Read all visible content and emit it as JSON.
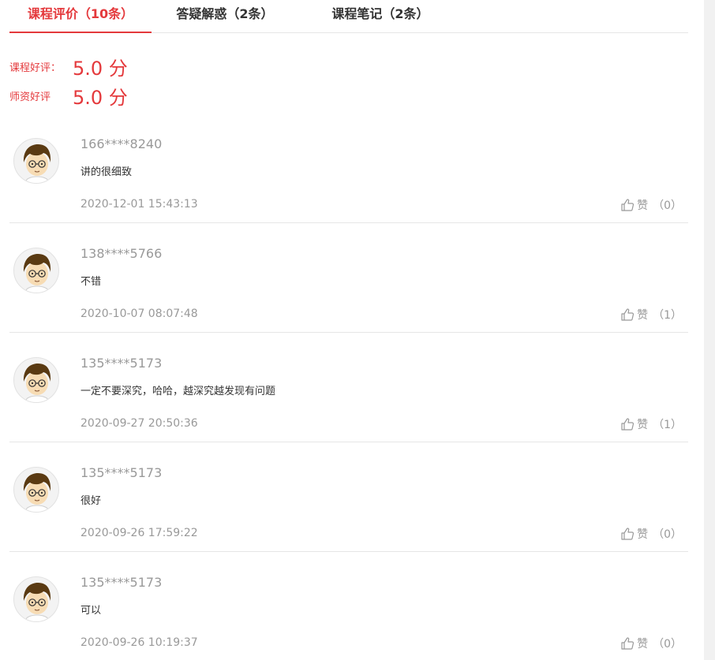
{
  "tabs": [
    {
      "label": "课程评价（10条）",
      "active": true
    },
    {
      "label": "答疑解惑（2条）",
      "active": false
    },
    {
      "label": "课程笔记（2条）",
      "active": false
    }
  ],
  "ratings": {
    "course_label": "课程好评：",
    "course_value": "5.0 分",
    "teacher_label": "师资好评",
    "teacher_value": "5.0 分"
  },
  "like_label": "赞",
  "comments": [
    {
      "user": "166****8240",
      "content": "讲的很细致",
      "time": "2020-12-01 15:43:13",
      "likes": "（0）"
    },
    {
      "user": "138****5766",
      "content": "不错",
      "time": "2020-10-07 08:07:48",
      "likes": "（1）"
    },
    {
      "user": "135****5173",
      "content": "一定不要深究，哈哈，越深究越发现有问题",
      "time": "2020-09-27 20:50:36",
      "likes": "（1）"
    },
    {
      "user": "135****5173",
      "content": "很好",
      "time": "2020-09-26 17:59:22",
      "likes": "（0）"
    },
    {
      "user": "135****5173",
      "content": "可以",
      "time": "2020-09-26 10:19:37",
      "likes": "（0）"
    }
  ],
  "colors": {
    "accent": "#e4393c",
    "muted": "#999999",
    "divider": "#e6e6e6"
  },
  "icons": {
    "avatar": "cartoon-boy-avatar-icon",
    "like": "thumbs-up-icon"
  }
}
